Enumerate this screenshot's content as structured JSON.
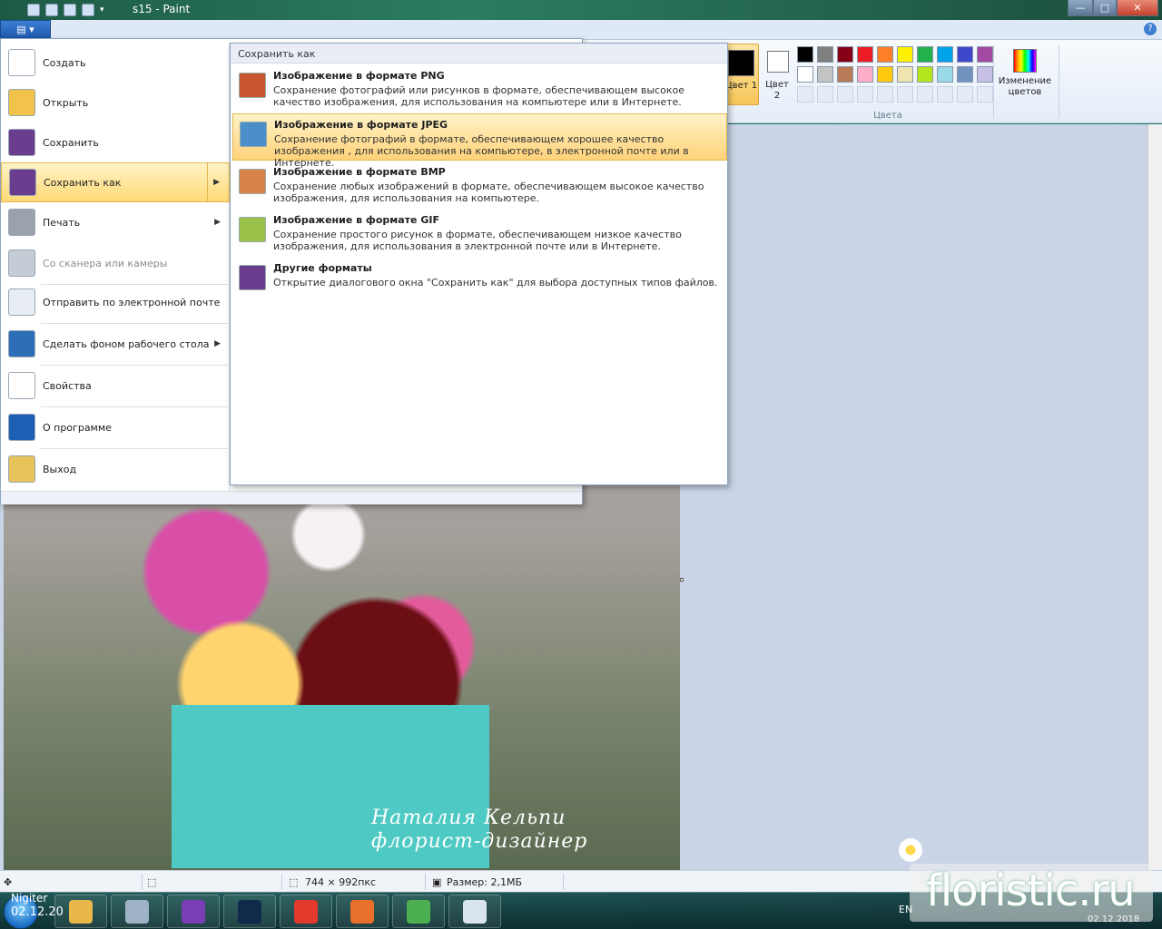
{
  "window": {
    "title": "s15 - Paint",
    "caption_buttons": {
      "minimize": "—",
      "maximize": "□",
      "close": "✕"
    },
    "help": "?"
  },
  "app_button": {
    "label": "▤ ▾"
  },
  "ribbon": {
    "color1_label": "Цвет 1",
    "color2_label": "Цвет 2",
    "colors_group_label": "Цвета",
    "edit_colors_label": "Изменение цветов",
    "palette_row1": [
      "#000000",
      "#7f7f7f",
      "#880015",
      "#ed1c24",
      "#ff7f27",
      "#fff200",
      "#22b14c",
      "#00a2e8",
      "#3f48cc",
      "#a349a4"
    ],
    "palette_row2": [
      "#ffffff",
      "#c3c3c3",
      "#b97a57",
      "#ffaec9",
      "#ffc90e",
      "#efe4b0",
      "#b5e61d",
      "#99d9ea",
      "#7092be",
      "#c8bfe7"
    ],
    "palette_row3": [
      "#e6ecf5",
      "#e6ecf5",
      "#e6ecf5",
      "#e6ecf5",
      "#e6ecf5",
      "#e6ecf5",
      "#e6ecf5",
      "#e6ecf5",
      "#e6ecf5",
      "#e6ecf5"
    ]
  },
  "file_menu": {
    "items": [
      {
        "label": "Создать",
        "icon": "new-file-icon",
        "color": "#ffffff"
      },
      {
        "label": "Открыть",
        "icon": "open-folder-icon",
        "color": "#f1c34a"
      },
      {
        "label": "Сохранить",
        "icon": "save-disk-icon",
        "color": "#6b3d8f"
      },
      {
        "label": "Сохранить как",
        "icon": "save-as-icon",
        "color": "#6b3d8f",
        "selected": true,
        "submenu": true
      },
      {
        "label": "Печать",
        "icon": "printer-icon",
        "color": "#9aa3ad",
        "submenu": true
      },
      {
        "label": "Со сканера или камеры",
        "icon": "scanner-icon",
        "color": "#c4ccd6",
        "disabled": true
      },
      {
        "label": "Отправить по электронной почте",
        "icon": "email-icon",
        "color": "#e8edf3"
      },
      {
        "label": "Сделать фоном рабочего стола",
        "icon": "desktop-background-icon",
        "color": "#2d6fb7",
        "submenu": true
      },
      {
        "label": "Свойства",
        "icon": "checkmark-icon",
        "color": "#ffffff"
      },
      {
        "label": "О программе",
        "icon": "info-icon",
        "color": "#1c5fb5"
      },
      {
        "label": "Выход",
        "icon": "exit-icon",
        "color": "#e8c25a"
      }
    ]
  },
  "save_as_submenu": {
    "header": "Сохранить как",
    "options": [
      {
        "title": "Изображение в формате PNG",
        "description": "Сохранение фотографий или рисунков в формате, обеспечивающем высокое качество изображения, для использования на компьютере или в Интернете.",
        "icon": "png-file-icon",
        "color": "#c8562e"
      },
      {
        "title": "Изображение в формате JPEG",
        "description": "Сохранение фотографий в формате, обеспечивающем хорошее качество изображения , для использования на компьютере, в электронной почте или в Интернете.",
        "icon": "jpeg-file-icon",
        "color": "#4a8fc9",
        "selected": true
      },
      {
        "title": "Изображение в формате BMP",
        "description": "Сохранение любых изображений в формате, обеспечивающем высокое качество изображения, для использования на компьютере.",
        "icon": "bmp-file-icon",
        "color": "#d9824a"
      },
      {
        "title": "Изображение в формате GIF",
        "description": "Сохранение простого рисунок в формате, обеспечивающем низкое качество изображения, для использования в электронной почте или в Интернете.",
        "icon": "gif-file-icon",
        "color": "#9bc24a"
      },
      {
        "title": "Другие форматы",
        "description": "Открытие диалогового окна \"Сохранить как\" для выбора доступных типов файлов.",
        "icon": "other-formats-icon",
        "color": "#6b3d8f"
      }
    ]
  },
  "canvas": {
    "caption_line1": "Наталия Кельпи",
    "caption_line2": "флорист-дизайнер"
  },
  "status_bar": {
    "image_size": "744 × 992пкс",
    "file_size": "Размер: 2,1МБ"
  },
  "taskbar": {
    "overlay_top": "Nigiter",
    "overlay_date": "02.12.20",
    "lang": "EN",
    "clock_date": "02.12.2018",
    "buttons": [
      {
        "name": "explorer",
        "color": "#e9b84a"
      },
      {
        "name": "calculator",
        "color": "#9fb3c8"
      },
      {
        "name": "visual-studio",
        "color": "#7a3fb5"
      },
      {
        "name": "photoshop",
        "color": "#0f2a4a"
      },
      {
        "name": "yandex-browser",
        "color": "#e23b2e"
      },
      {
        "name": "firefox",
        "color": "#e8702a"
      },
      {
        "name": "picasa",
        "color": "#4caf50"
      },
      {
        "name": "paint",
        "color": "#d9e4ef"
      }
    ]
  },
  "watermark": {
    "text": "floristic.ru"
  }
}
